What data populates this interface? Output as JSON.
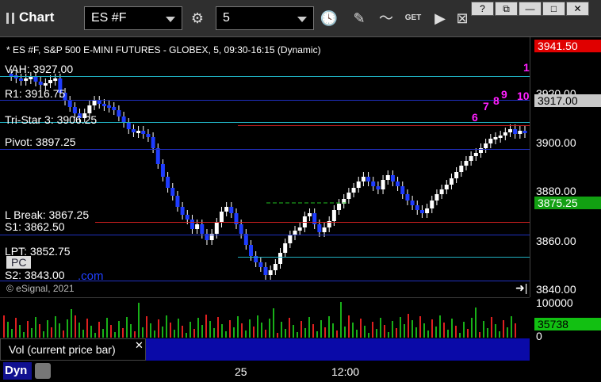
{
  "app": {
    "title": "Chart"
  },
  "toolbar": {
    "symbol": "ES #F",
    "interval": "5",
    "study_label": "GET"
  },
  "header": {
    "text": "* ES #F, S&P 500 E-MINI FUTURES - GLOBEX, 5, 09:30-16:15 (Dynamic)"
  },
  "levels": {
    "vah": "VAH: 3927.00",
    "r1": "R1: 3916.75",
    "tristar": "Tri-Star 3: 3906.25",
    "pivot": "Pivot: 3897.25",
    "lbreak": "L Break: 3867.25",
    "s1": "S1: 3862.50",
    "lpt": "LPT: 3852.75",
    "pc": "PC",
    "s2": "S2: 3843.00",
    "com": ".com"
  },
  "axis": {
    "ticks": [
      "3920.00",
      "3900.00",
      "3880.00",
      "3860.00",
      "3840.00"
    ],
    "price_top": "3941.50",
    "price_last": "3917.00",
    "price_green": "3875.25",
    "top_color": "#e00000",
    "last_color": "#c8c8c8",
    "green_color": "#12a012"
  },
  "volume": {
    "scale": "100000",
    "zero": "0",
    "last": "35738",
    "title": "Vol (current price bar)"
  },
  "time_axis": [
    "25",
    "12:00"
  ],
  "footer": {
    "copyright": "© eSignal, 2021",
    "status": "Dyn"
  },
  "seq_numbers": [
    "1",
    "9",
    "8",
    "7",
    "6",
    "10"
  ]
}
